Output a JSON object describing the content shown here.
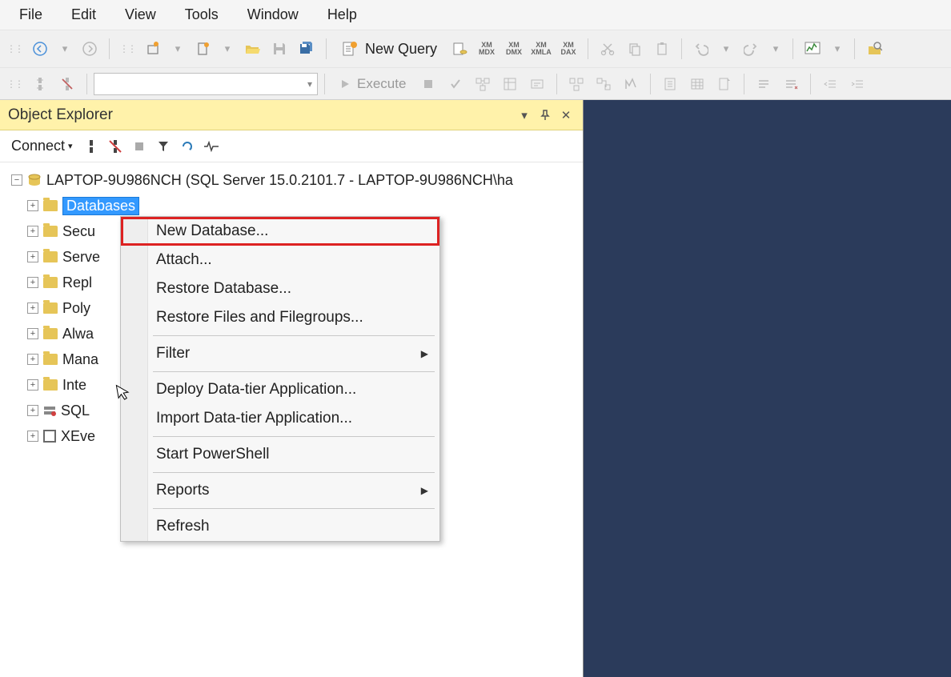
{
  "menu": {
    "file": "File",
    "edit": "Edit",
    "view": "View",
    "tools": "Tools",
    "window": "Window",
    "help": "Help"
  },
  "toolbar": {
    "new_query": "New Query",
    "execute": "Execute"
  },
  "object_explorer": {
    "title": "Object Explorer",
    "connect": "Connect",
    "server": "LAPTOP-9U986NCH (SQL Server 15.0.2101.7 - LAPTOP-9U986NCH\\ha",
    "nodes": {
      "databases": "Databases",
      "security": "Secu",
      "server_objects": "Serve",
      "replication": "Repl",
      "polybase": "Poly",
      "always_on": "Alwa",
      "management": "Mana",
      "integration": "Inte",
      "sql_agent": "SQL",
      "xevent": "XEve"
    }
  },
  "context_menu": {
    "new_database": "New Database...",
    "attach": "Attach...",
    "restore_database": "Restore Database...",
    "restore_files": "Restore Files and Filegroups...",
    "filter": "Filter",
    "deploy_data_tier": "Deploy Data-tier Application...",
    "import_data_tier": "Import Data-tier Application...",
    "start_powershell": "Start PowerShell",
    "reports": "Reports",
    "refresh": "Refresh"
  }
}
